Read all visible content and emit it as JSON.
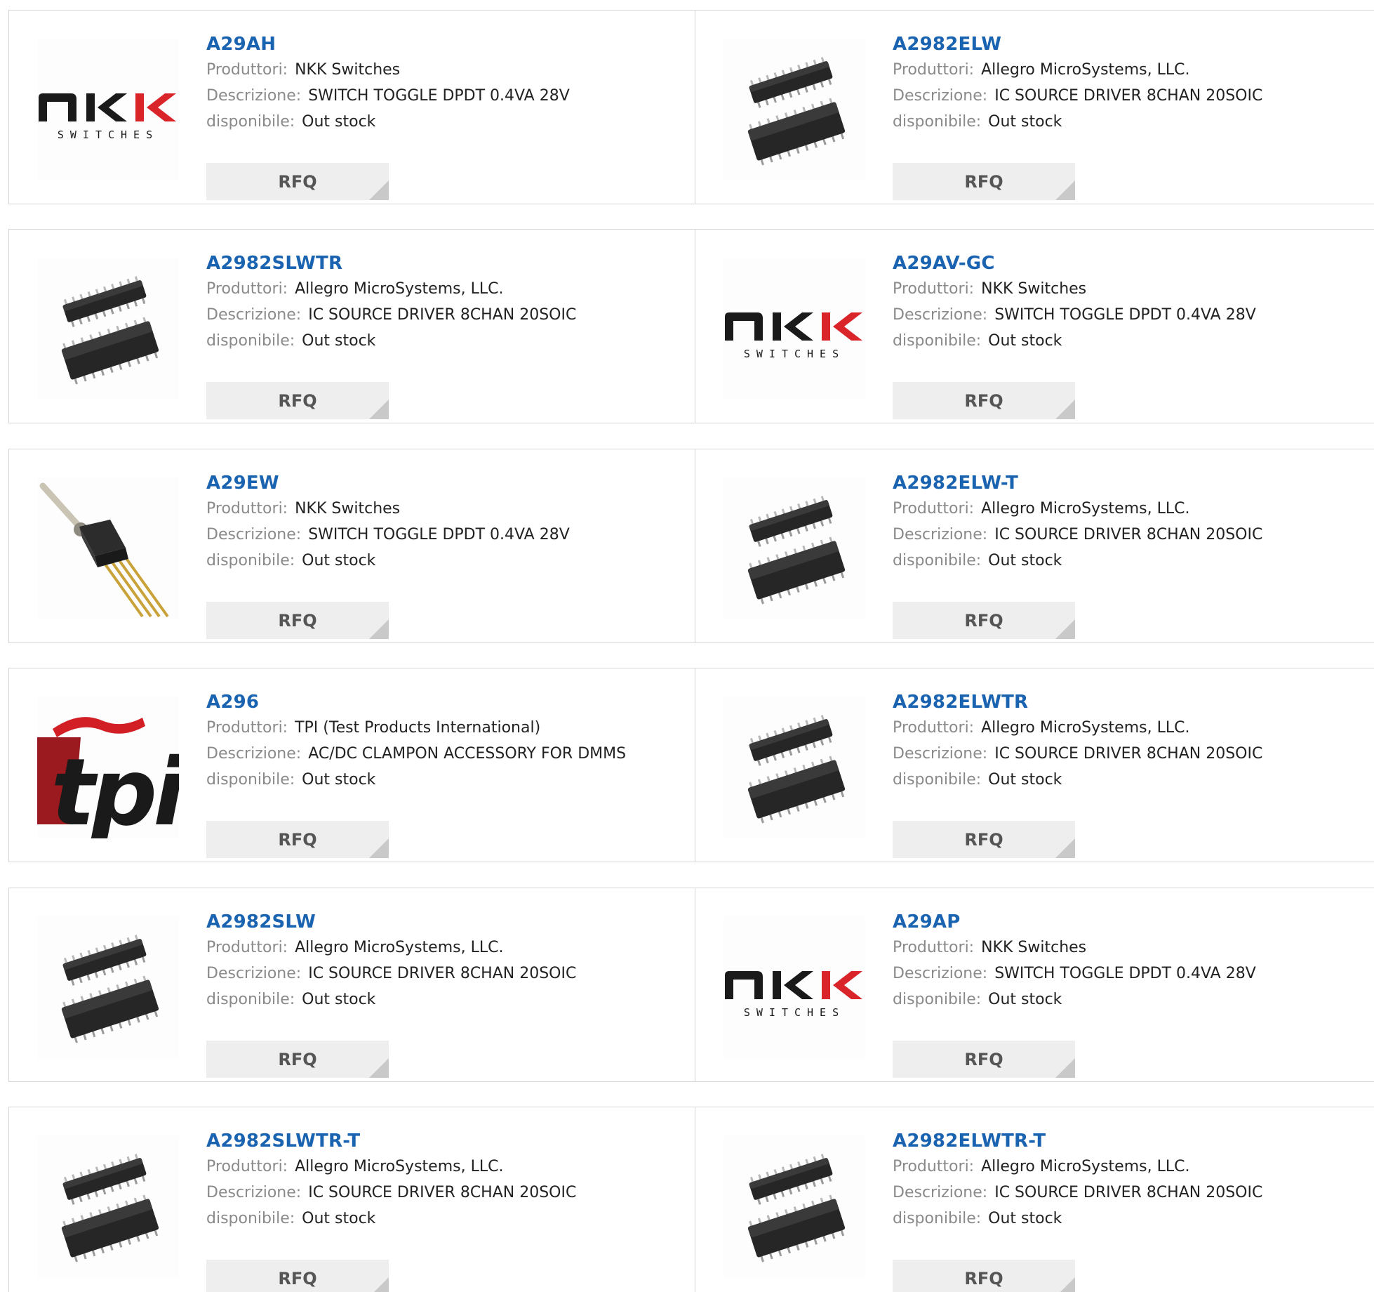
{
  "labels": {
    "manufacturer": "Produttori:",
    "description": "Descrizione:",
    "availability": "disponibile:"
  },
  "products": [
    {
      "part": "A29AH",
      "manufacturer": "NKK Switches",
      "description": "SWITCH TOGGLE DPDT 0.4VA 28V",
      "availability": "Out stock",
      "button": "RFQ",
      "image": "nkk-switches-logo"
    },
    {
      "part": "A2982ELW",
      "manufacturer": "Allegro MicroSystems, LLC.",
      "description": "IC SOURCE DRIVER 8CHAN 20SOIC",
      "availability": "Out stock",
      "button": "RFQ",
      "image": "soic-chip-photo"
    },
    {
      "part": "A2982SLWTR",
      "manufacturer": "Allegro MicroSystems, LLC.",
      "description": "IC SOURCE DRIVER 8CHAN 20SOIC",
      "availability": "Out stock",
      "button": "RFQ",
      "image": "soic-chip-photo"
    },
    {
      "part": "A29AV-GC",
      "manufacturer": "NKK Switches",
      "description": "SWITCH TOGGLE DPDT 0.4VA 28V",
      "availability": "Out stock",
      "button": "RFQ",
      "image": "nkk-switches-logo"
    },
    {
      "part": "A29EW",
      "manufacturer": "NKK Switches",
      "description": "SWITCH TOGGLE DPDT 0.4VA 28V",
      "availability": "Out stock",
      "button": "RFQ",
      "image": "toggle-switch-photo"
    },
    {
      "part": "A2982ELW-T",
      "manufacturer": "Allegro MicroSystems, LLC.",
      "description": "IC SOURCE DRIVER 8CHAN 20SOIC",
      "availability": "Out stock",
      "button": "RFQ",
      "image": "soic-chip-photo"
    },
    {
      "part": "A296",
      "manufacturer": "TPI (Test Products International)",
      "description": "AC/DC CLAMPON ACCESSORY FOR DMMS",
      "availability": "Out stock",
      "button": "RFQ",
      "image": "tpi-logo"
    },
    {
      "part": "A2982ELWTR",
      "manufacturer": "Allegro MicroSystems, LLC.",
      "description": "IC SOURCE DRIVER 8CHAN 20SOIC",
      "availability": "Out stock",
      "button": "RFQ",
      "image": "soic-chip-photo"
    },
    {
      "part": "A2982SLW",
      "manufacturer": "Allegro MicroSystems, LLC.",
      "description": "IC SOURCE DRIVER 8CHAN 20SOIC",
      "availability": "Out stock",
      "button": "RFQ",
      "image": "soic-chip-photo"
    },
    {
      "part": "A29AP",
      "manufacturer": "NKK Switches",
      "description": "SWITCH TOGGLE DPDT 0.4VA 28V",
      "availability": "Out stock",
      "button": "RFQ",
      "image": "nkk-switches-logo"
    },
    {
      "part": "A2982SLWTR-T",
      "manufacturer": "Allegro MicroSystems, LLC.",
      "description": "IC SOURCE DRIVER 8CHAN 20SOIC",
      "availability": "Out stock",
      "button": "RFQ",
      "image": "soic-chip-photo"
    },
    {
      "part": "A2982ELWTR-T",
      "manufacturer": "Allegro MicroSystems, LLC.",
      "description": "IC SOURCE DRIVER 8CHAN 20SOIC",
      "availability": "Out stock",
      "button": "RFQ",
      "image": "soic-chip-photo"
    }
  ],
  "logos": {
    "nkk": {
      "wordmark": "NKK",
      "tagline": "SWITCHES"
    },
    "tpi": {
      "wordmark": "tpi"
    }
  },
  "colors": {
    "part_link": "#1a63b0",
    "label": "#8a8a8a",
    "value": "#222222",
    "button_bg": "#eeeeee",
    "button_text": "#555555",
    "border": "#d6d6d6",
    "nkk_red": "#d9242a",
    "tpi_red": "#d21f26"
  }
}
